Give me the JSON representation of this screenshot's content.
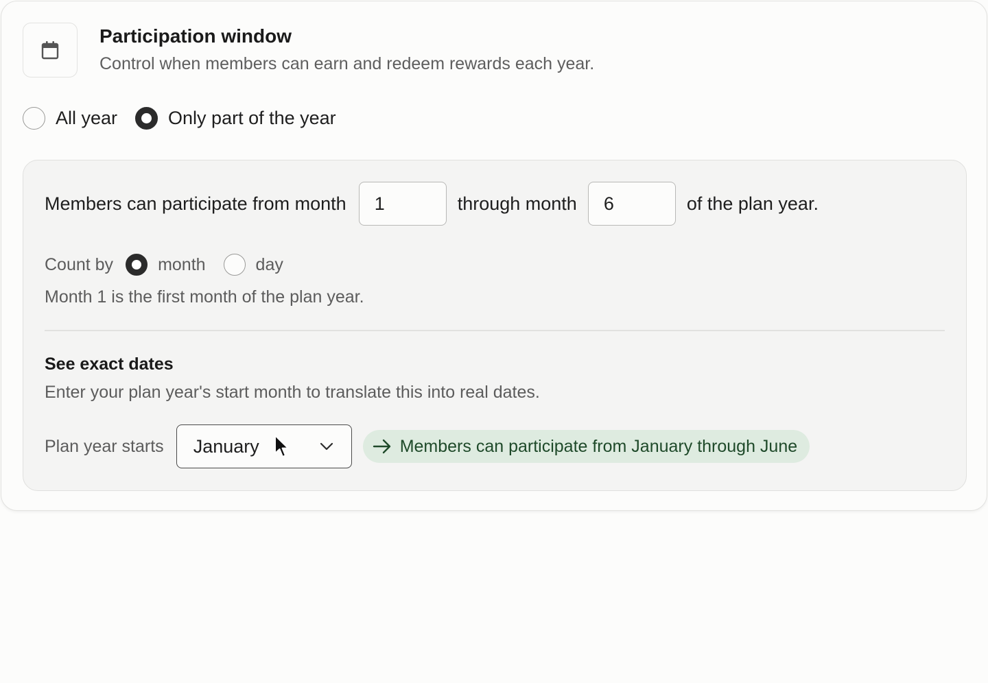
{
  "header": {
    "icon": "calendar-icon",
    "title": "Participation window",
    "subtitle": "Control when members can earn and redeem rewards each year."
  },
  "mode": {
    "options": [
      {
        "label": "All year",
        "checked": false
      },
      {
        "label": "Only part of the year",
        "checked": true
      }
    ]
  },
  "range": {
    "prefix": "Members can participate from month",
    "start_value": "1",
    "middle": "through month",
    "end_value": "6",
    "suffix": "of the plan year."
  },
  "count_by": {
    "label": "Count by",
    "options": [
      {
        "label": "month",
        "checked": true
      },
      {
        "label": "day",
        "checked": false
      }
    ],
    "hint": "Month 1 is the first month of the plan year."
  },
  "exact_dates": {
    "title": "See exact dates",
    "subtitle": "Enter your plan year's start month to translate this into real dates.",
    "start_label": "Plan year starts",
    "selected_month": "January",
    "result": "Members can participate from January through June"
  },
  "colors": {
    "accent": "#2b2b2b",
    "result_bg": "#deebe0",
    "result_text": "#1f4a2a"
  }
}
